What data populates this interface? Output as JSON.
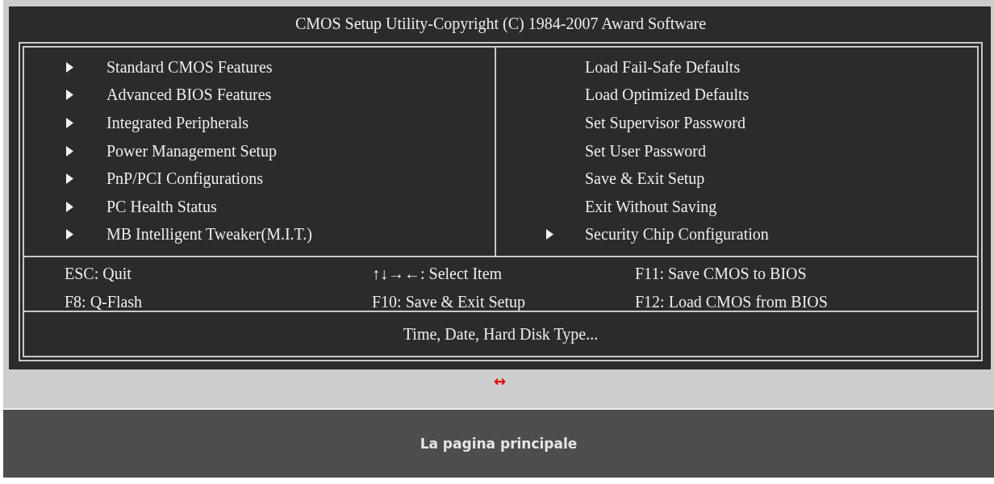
{
  "bios_screen": {
    "title": "CMOS Setup Utility-Copyright (C) 1984-2007 Award Software",
    "left_menu": [
      {
        "label": "Standard CMOS Features",
        "submenu": true
      },
      {
        "label": "Advanced BIOS Features",
        "submenu": true
      },
      {
        "label": "Integrated Peripherals",
        "submenu": true
      },
      {
        "label": "Power Management Setup",
        "submenu": true
      },
      {
        "label": "PnP/PCI Configurations",
        "submenu": true
      },
      {
        "label": "PC Health Status",
        "submenu": true
      },
      {
        "label": "MB Intelligent Tweaker(M.I.T.)",
        "submenu": true
      }
    ],
    "right_menu": [
      {
        "label": "Load Fail-Safe Defaults",
        "submenu": false
      },
      {
        "label": "Load Optimized Defaults",
        "submenu": false
      },
      {
        "label": "Set Supervisor Password",
        "submenu": false
      },
      {
        "label": "Set User Password",
        "submenu": false
      },
      {
        "label": "Save & Exit Setup",
        "submenu": false
      },
      {
        "label": "Exit Without Saving",
        "submenu": false
      },
      {
        "label": "Security Chip Configuration",
        "submenu": true
      }
    ],
    "key_hints": [
      [
        "ESC: Quit",
        "↑↓→←: Select Item",
        "F11: Save CMOS to BIOS"
      ],
      [
        "F8: Q-Flash",
        "F10: Save & Exit Setup",
        "F12: Load CMOS from BIOS"
      ]
    ],
    "help_text": "Time, Date, Hard Disk Type..."
  },
  "resize_link": "↔",
  "caption": "La pagina principale"
}
